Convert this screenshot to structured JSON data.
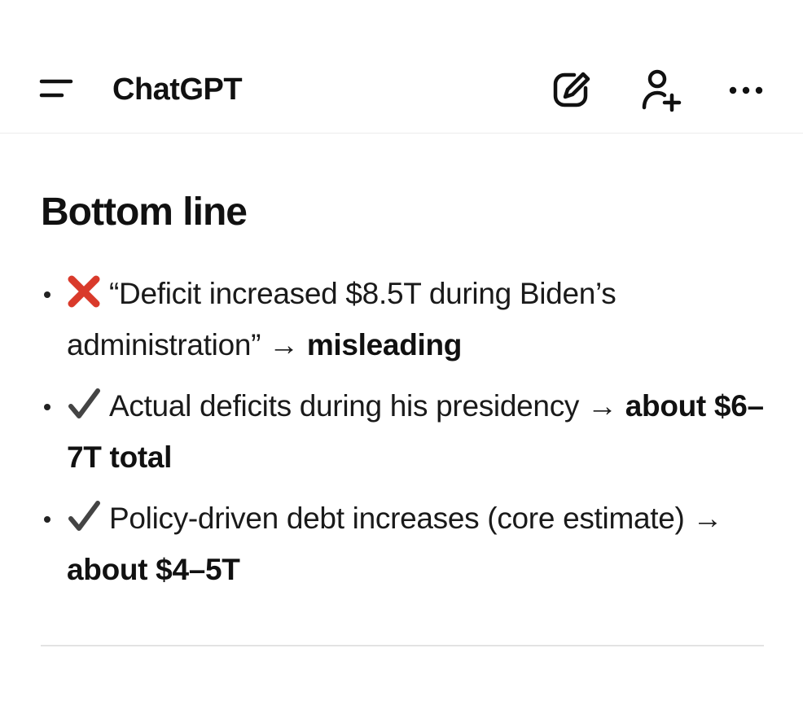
{
  "header": {
    "title": "ChatGPT",
    "menu_icon": "menu-icon",
    "new_chat_icon": "edit-icon",
    "add_person_icon": "add-person-icon",
    "more_icon": "more-icon"
  },
  "message": {
    "heading": "Bottom line",
    "bullets": [
      {
        "mark": "cross-mark-icon",
        "text_before": "“Deficit increased $8.5T during Biden’s administration” → ",
        "bold": "misleading"
      },
      {
        "mark": "check-mark-icon",
        "text_before": "Actual deficits during his presidency → ",
        "bold": "about $6–7T total"
      },
      {
        "mark": "check-mark-icon",
        "text_before": "Policy-driven debt increases (core estimate) → ",
        "bold": "about $4–5T"
      }
    ]
  },
  "colors": {
    "cross_mark": "#d93a2b",
    "check_mark": "#444444",
    "text": "#1a1a1a",
    "divider": "#e3e3e3"
  }
}
